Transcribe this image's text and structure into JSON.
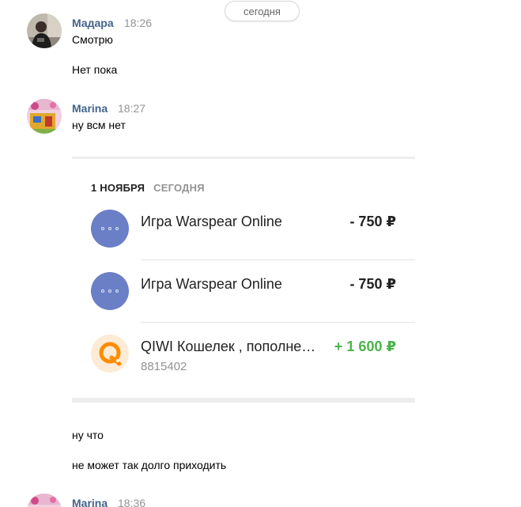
{
  "date_divider": "сегодня",
  "messages": [
    {
      "author": "Мадара",
      "time": "18:26",
      "lines": [
        "Смотрю",
        "Нет пока"
      ]
    },
    {
      "author": "Marina",
      "time": "18:27",
      "lines": [
        "ну всм нет"
      ]
    }
  ],
  "card": {
    "date_primary": "1 НОЯБРЯ",
    "date_secondary": "СЕГОДНЯ",
    "transactions": [
      {
        "name": "Игра Warspear Online",
        "amount": "- 750 ₽",
        "icon": "more-dots-icon",
        "sign": "negative"
      },
      {
        "name": "Игра Warspear Online",
        "amount": "- 750 ₽",
        "icon": "more-dots-icon",
        "sign": "negative"
      },
      {
        "name": "QIWI Кошелек , пополне…",
        "sub": "8815402",
        "amount": "+ 1 600 ₽",
        "icon": "qiwi-logo-icon",
        "sign": "positive"
      }
    ]
  },
  "after_card_lines": [
    "ну что",
    "не может так долго приходить"
  ],
  "last_message": {
    "author": "Marina",
    "time": "18:36"
  },
  "colors": {
    "author": "#42648b",
    "time": "#939393",
    "positive_amount": "#4bb34b",
    "icon_bg_dots": "#6b7fc7",
    "qiwi_orange": "#ff8c00"
  }
}
